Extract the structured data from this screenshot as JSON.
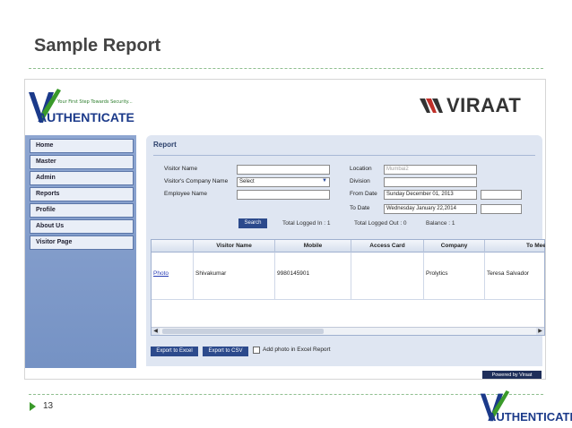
{
  "slide": {
    "title": "Sample Report",
    "page_number": "13",
    "green_accent": "#3a9a2a"
  },
  "header": {
    "logo_tagline": "Your First Step Towards Security...",
    "logo_word": "AUTHENTICATE",
    "brand_right": "VIRAAT"
  },
  "sidebar": {
    "items": [
      {
        "label": "Home"
      },
      {
        "label": "Master"
      },
      {
        "label": "Admin"
      },
      {
        "label": "Reports"
      },
      {
        "label": "Profile"
      },
      {
        "label": "About Us"
      },
      {
        "label": "Visitor Page"
      }
    ]
  },
  "report": {
    "title": "Report",
    "fields": {
      "visitor_name_label": "Visitor Name",
      "visitor_name_value": "",
      "company_label": "Visitor's Company Name",
      "company_value": "Select",
      "employee_label": "Employee Name",
      "employee_value": "",
      "location_label": "Location",
      "location_value": "Mumbai2",
      "division_label": "Division",
      "division_value": "",
      "from_label": "From Date",
      "from_value": "Sunday December 01, 2013",
      "from_time": "",
      "to_label": "To Date",
      "to_value": "Wednesday January 22,2014",
      "to_time": ""
    },
    "search_label": "Search",
    "stats": {
      "logged_in": "Total Logged In : 1",
      "logged_out": "Total Logged Out : 0",
      "balance": "Balance : 1"
    },
    "table": {
      "columns": [
        "",
        "Visitor Name",
        "Mobile",
        "Access Card",
        "Company",
        "To Meet"
      ],
      "rows": [
        {
          "photo": "Photo",
          "visitor_name": "Shivakumar",
          "mobile": "9980145901",
          "access_card": "",
          "company": "Prolytics",
          "to_meet": "Teresa Salvador"
        }
      ]
    },
    "export_excel": "Export to Excel",
    "export_csv": "Export to CSV",
    "add_photo_label": "Add photo in Excel Report",
    "add_photo_checked": false
  },
  "footer": {
    "powered_by": "Powered by Viraat"
  },
  "colors": {
    "sidebar": "#7f9bcb",
    "panel": "#dfe6f2",
    "button": "#2c4a8c",
    "logo_blue": "#1b3a8a",
    "logo_green": "#3a9a2a"
  }
}
